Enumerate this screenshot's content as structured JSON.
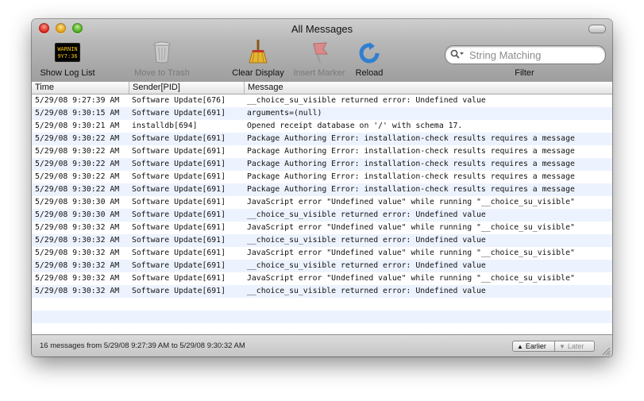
{
  "window": {
    "title": "All Messages"
  },
  "toolbar": {
    "show_log_list": "Show Log List",
    "move_to_trash": "Move to Trash",
    "clear_display": "Clear Display",
    "insert_marker": "Insert Marker",
    "reload": "Reload",
    "filter": "Filter",
    "log_icon_text_top": "WARNIN",
    "log_icon_text_bottom": "9Y7:36"
  },
  "search": {
    "placeholder": "String Matching",
    "value": ""
  },
  "table": {
    "headers": {
      "time": "Time",
      "sender": "Sender[PID]",
      "message": "Message"
    },
    "rows": [
      {
        "time": "5/29/08 9:27:39 AM",
        "sender": "Software Update[676]",
        "message": "__choice_su_visible returned error: Undefined value"
      },
      {
        "time": "5/29/08 9:30:15 AM",
        "sender": "Software Update[691]",
        "message": "arguments=(null)"
      },
      {
        "time": "5/29/08 9:30:21 AM",
        "sender": "installdb[694]",
        "message": "Opened receipt database on '/' with schema 17."
      },
      {
        "time": "5/29/08 9:30:22 AM",
        "sender": "Software Update[691]",
        "message": "Package Authoring Error: installation-check results requires a message"
      },
      {
        "time": "5/29/08 9:30:22 AM",
        "sender": "Software Update[691]",
        "message": "Package Authoring Error: installation-check results requires a message"
      },
      {
        "time": "5/29/08 9:30:22 AM",
        "sender": "Software Update[691]",
        "message": "Package Authoring Error: installation-check results requires a message"
      },
      {
        "time": "5/29/08 9:30:22 AM",
        "sender": "Software Update[691]",
        "message": "Package Authoring Error: installation-check results requires a message"
      },
      {
        "time": "5/29/08 9:30:22 AM",
        "sender": "Software Update[691]",
        "message": "Package Authoring Error: installation-check results requires a message"
      },
      {
        "time": "5/29/08 9:30:30 AM",
        "sender": "Software Update[691]",
        "message": "JavaScript error \"Undefined value\" while running \"__choice_su_visible\""
      },
      {
        "time": "5/29/08 9:30:30 AM",
        "sender": "Software Update[691]",
        "message": "__choice_su_visible returned error: Undefined value"
      },
      {
        "time": "5/29/08 9:30:32 AM",
        "sender": "Software Update[691]",
        "message": "JavaScript error \"Undefined value\" while running \"__choice_su_visible\""
      },
      {
        "time": "5/29/08 9:30:32 AM",
        "sender": "Software Update[691]",
        "message": "__choice_su_visible returned error: Undefined value"
      },
      {
        "time": "5/29/08 9:30:32 AM",
        "sender": "Software Update[691]",
        "message": "JavaScript error \"Undefined value\" while running \"__choice_su_visible\""
      },
      {
        "time": "5/29/08 9:30:32 AM",
        "sender": "Software Update[691]",
        "message": "__choice_su_visible returned error: Undefined value"
      },
      {
        "time": "5/29/08 9:30:32 AM",
        "sender": "Software Update[691]",
        "message": "JavaScript error \"Undefined value\" while running \"__choice_su_visible\""
      },
      {
        "time": "5/29/08 9:30:32 AM",
        "sender": "Software Update[691]",
        "message": "__choice_su_visible returned error: Undefined value"
      }
    ]
  },
  "status": {
    "summary": "16 messages from 5/29/08 9:27:39 AM to 5/29/08 9:30:32 AM",
    "earlier": "Earlier",
    "later": "Later"
  },
  "colors": {
    "row_alt": "#edf3fe",
    "close": "#d9261c",
    "minimize": "#e0a31a",
    "zoom": "#4caa23",
    "reload_accent": "#2f7fd1"
  }
}
